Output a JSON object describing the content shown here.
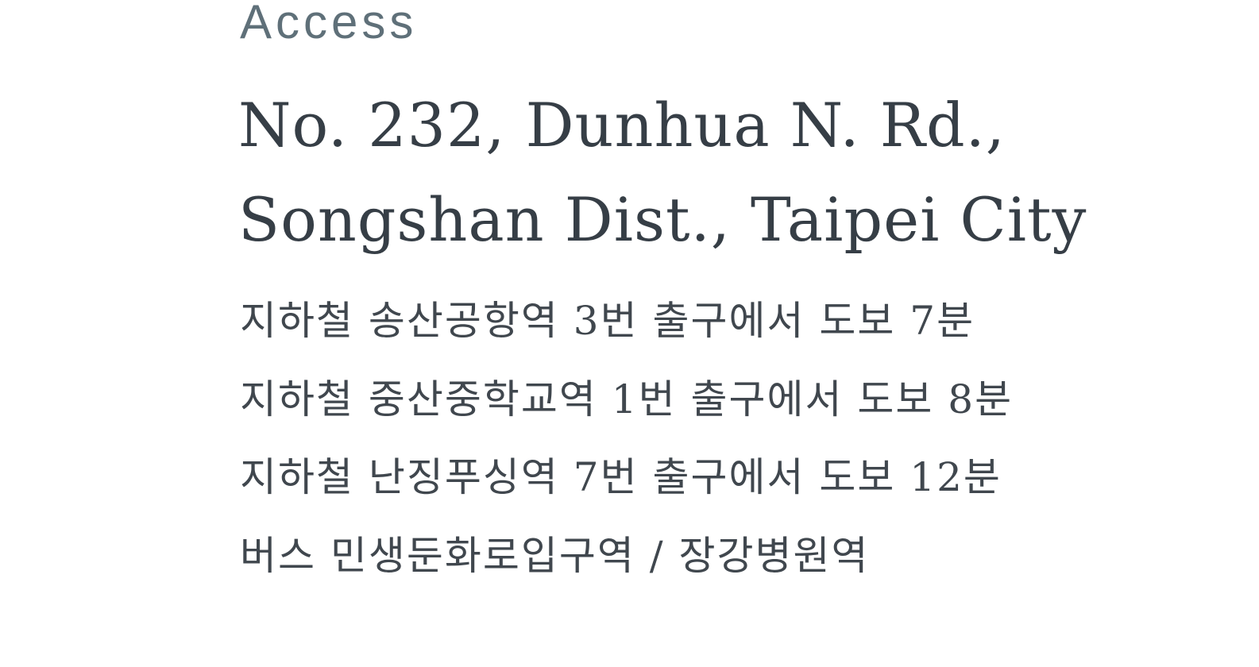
{
  "access": {
    "label": "Access",
    "address_line_1": "No. 232, Dunhua N. Rd.,",
    "address_line_2": "Songshan Dist., Taipei City",
    "directions": [
      "지하철 송산공항역 3번 출구에서 도보 7분",
      "지하철 중산중학교역 1번 출구에서 도보 8분",
      "지하철 난징푸싱역 7번 출구에서 도보 12분",
      "버스 민생둔화로입구역 / 장강병원역"
    ]
  }
}
